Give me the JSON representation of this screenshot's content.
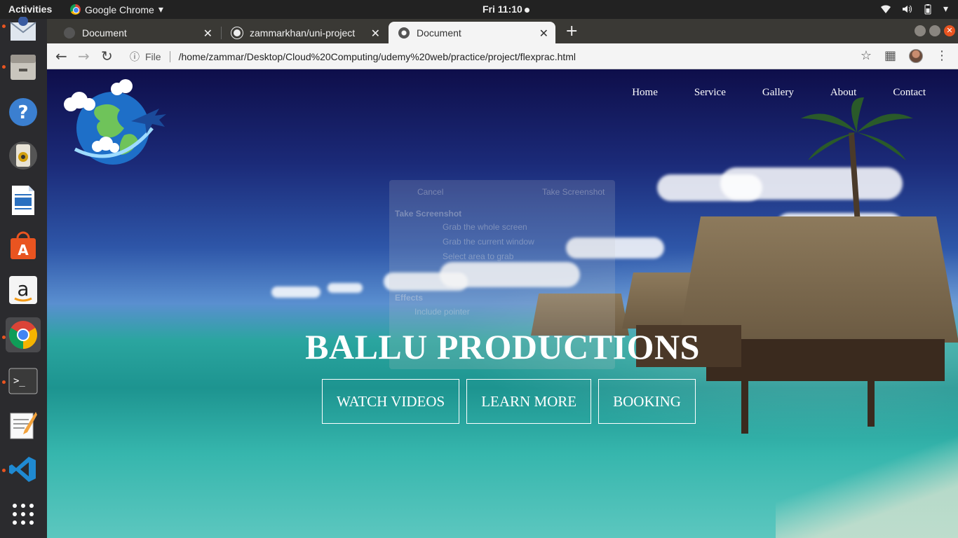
{
  "system": {
    "activities": "Activities",
    "app_name": "Google Chrome",
    "clock": "Fri 11:10"
  },
  "browser": {
    "tabs": [
      {
        "title": "Document",
        "active": false
      },
      {
        "title": "zammarkhan/uni-project",
        "active": false
      },
      {
        "title": "Document",
        "active": true
      }
    ],
    "url_scheme": "File",
    "url": "/home/zammar/Desktop/Cloud%20Computing/udemy%20web/practice/project/flexprac.html"
  },
  "dock": {
    "apps": [
      "thunderbird-icon",
      "files-icon",
      "help-icon",
      "rhythmbox-icon",
      "writer-icon",
      "software-center-icon",
      "amazon-icon",
      "chrome-icon",
      "terminal-icon",
      "text-editor-icon",
      "vscode-icon",
      "show-apps-icon"
    ]
  },
  "site": {
    "nav": [
      "Home",
      "Service",
      "Gallery",
      "About",
      "Contact"
    ],
    "hero_title": "BALLU PRODUCTIONS",
    "buttons": [
      "WATCH VIDEOS",
      "LEARN MORE",
      "BOOKING"
    ]
  },
  "ghost_dialog": {
    "cancel": "Cancel",
    "take": "Take Screenshot",
    "heading": "Take Screenshot",
    "options": [
      "Grab the whole screen",
      "Grab the current window",
      "Select area to grab"
    ],
    "effects": "Effects",
    "include_pointer": "Include pointer"
  },
  "colors": {
    "accent_dot": "#e95420",
    "dock_bg": "#2b2b2e",
    "tabstrip_bg": "#3a3935"
  }
}
